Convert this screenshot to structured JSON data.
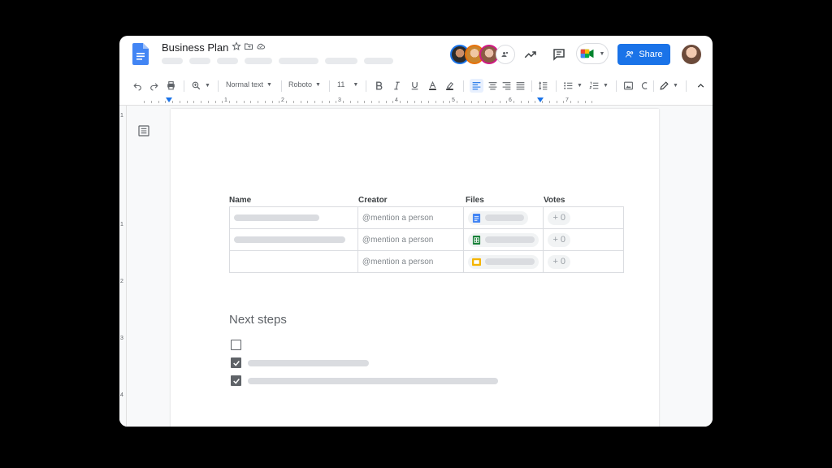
{
  "header": {
    "title": "Business Plan",
    "share_label": "Share",
    "icons": [
      "star-icon",
      "folder-move-icon",
      "cloud-saved-icon",
      "trending-icon",
      "comment-icon",
      "meet-icon"
    ]
  },
  "toolbar": {
    "style_label": "Normal text",
    "font_label": "Roboto",
    "size_label": "11"
  },
  "ruler": {
    "numbers": [
      "1",
      "2",
      "3",
      "4",
      "5",
      "6",
      "7"
    ],
    "left_numbers": [
      "1",
      "1",
      "2",
      "3",
      "4"
    ]
  },
  "table": {
    "headers": [
      "Name",
      "Creator",
      "Files",
      "Votes"
    ],
    "rows": [
      {
        "creator": "@mention a person",
        "file_type": "docs",
        "votes_label": "+ 0"
      },
      {
        "creator": "@mention a person",
        "file_type": "sheets",
        "votes_label": "+ 0"
      },
      {
        "creator": "@mention a person",
        "file_type": "slides",
        "votes_label": "+ 0"
      }
    ]
  },
  "next_steps": {
    "heading": "Next steps",
    "items": [
      {
        "checked": false
      },
      {
        "checked": true
      },
      {
        "checked": true
      }
    ]
  },
  "colors": {
    "accent": "#1a73e8",
    "docs": "#4285f4",
    "sheets": "#188038",
    "slides": "#f4b400"
  }
}
